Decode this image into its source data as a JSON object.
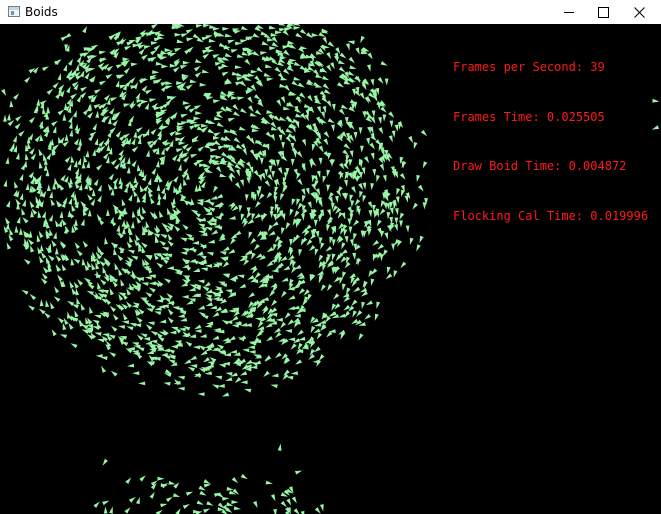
{
  "window": {
    "title": "Boids",
    "controls": {
      "minimize_icon": "minimize-icon",
      "maximize_icon": "maximize-icon",
      "close_icon": "close-icon"
    }
  },
  "stats": {
    "fps_line": "Frames per Second: 39",
    "frame_time_line": "Frames Time: 0.025505",
    "draw_time_line": "Draw Boid Time: 0.004872",
    "flocking_time_line": "Flocking Cal Time: 0.019996"
  },
  "colors": {
    "background": "#000000",
    "boid": "#98f5a6",
    "stats_text": "#ff1a1a",
    "titlebar": "#ffffff"
  }
}
